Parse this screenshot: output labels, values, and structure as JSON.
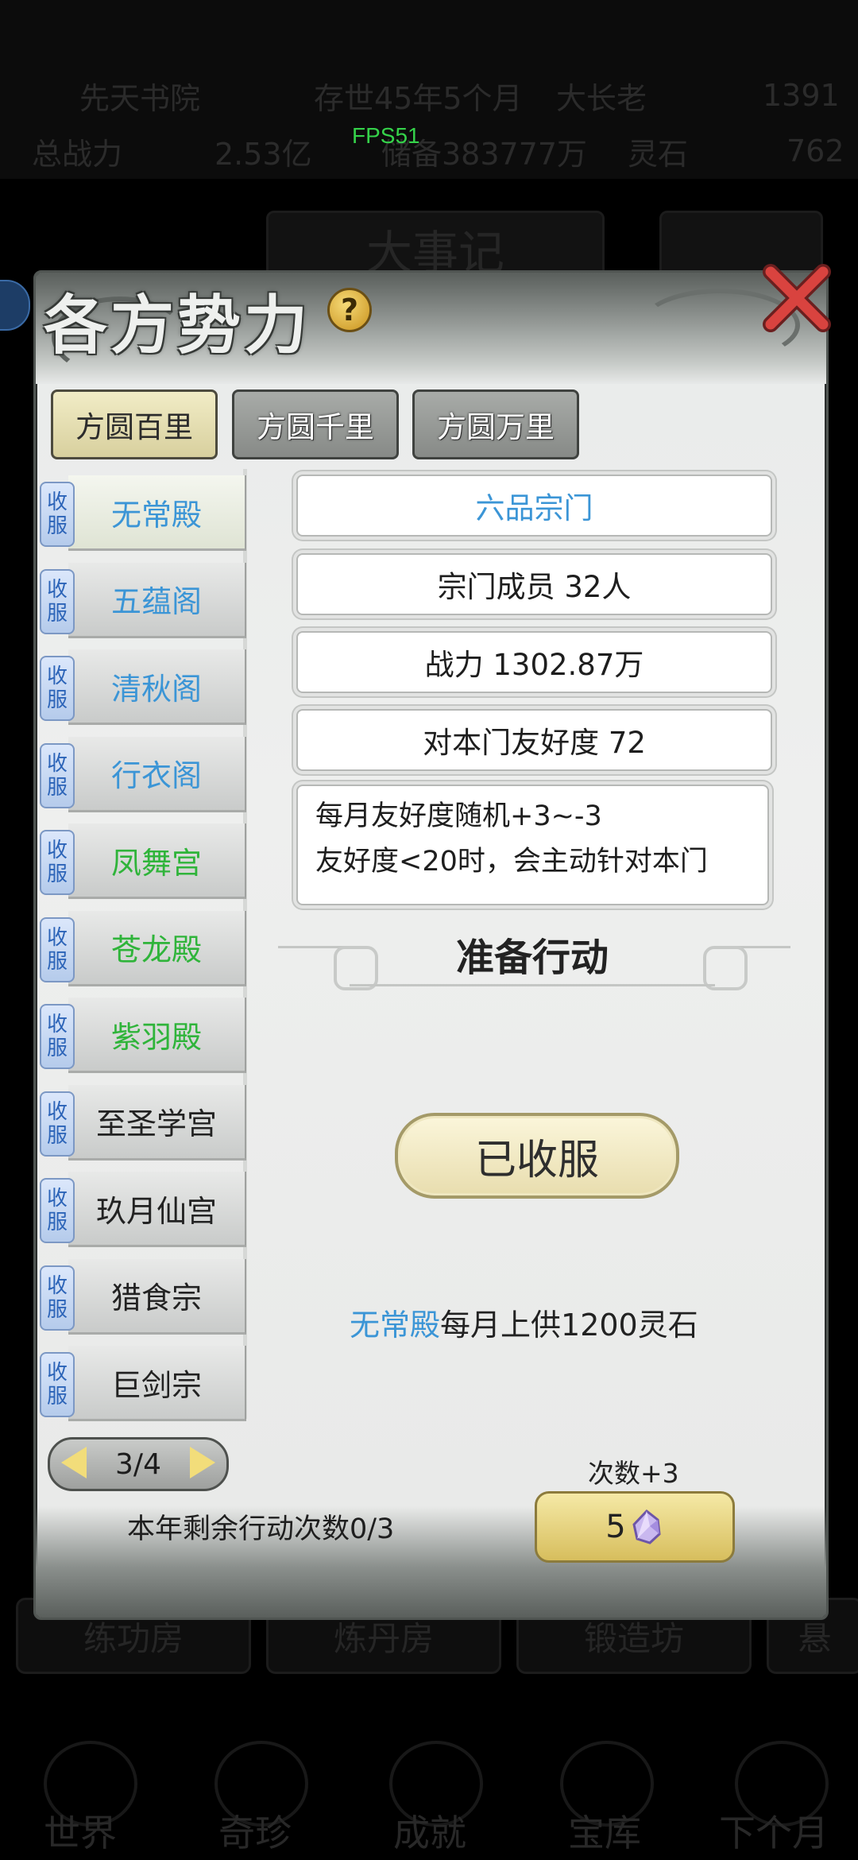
{
  "background": {
    "stats_row1": [
      "先天书院",
      "存世45年5个月",
      "大长老",
      "1391"
    ],
    "stats_row2": [
      "总战力",
      "2.53亿",
      "储备383777万",
      "灵石",
      "762"
    ],
    "fps": "FPS51",
    "tab_center": "大事记",
    "bottom_buildings": [
      "练功房",
      "炼丹房",
      "锻造坊",
      "悬"
    ],
    "nav": [
      "世界",
      "奇珍",
      "成就",
      "宝库",
      "下个月"
    ]
  },
  "dialog": {
    "title": "各方势力",
    "help_label": "?",
    "region_tabs": [
      "方圆百里",
      "方圆千里",
      "方圆万里"
    ],
    "sect_badge": "收服",
    "sects": [
      {
        "name": "无常殿",
        "color": "#3b95d6"
      },
      {
        "name": "五蕴阁",
        "color": "#3b95d6"
      },
      {
        "name": "清秋阁",
        "color": "#3b95d6"
      },
      {
        "name": "行衣阁",
        "color": "#3b95d6"
      },
      {
        "name": "凤舞宫",
        "color": "#2fb43a"
      },
      {
        "name": "苍龙殿",
        "color": "#2fb43a"
      },
      {
        "name": "紫羽殿",
        "color": "#2fb43a"
      },
      {
        "name": "至圣学宫",
        "color": "#222222"
      },
      {
        "name": "玖月仙宫",
        "color": "#222222"
      },
      {
        "name": "猎食宗",
        "color": "#222222"
      },
      {
        "name": "巨剑宗",
        "color": "#222222"
      }
    ],
    "detail": {
      "rank": "六品宗门",
      "rank_color": "#3b95d6",
      "members": "宗门成员 32人",
      "power": "战力 1302.87万",
      "friendship": "对本门友好度 72",
      "desc_line1": "每月友好度随机+3~-3",
      "desc_line2": "友好度<20时，会主动针对本门",
      "action_title": "准备行动",
      "status_button": "已收服",
      "tribute_sect": "无常殿",
      "tribute_text": "每月上供1200灵石"
    },
    "pager": "3/4",
    "remaining_actions": "本年剩余行动次数0/3",
    "count_label": "次数+3",
    "buy_cost": "5"
  }
}
